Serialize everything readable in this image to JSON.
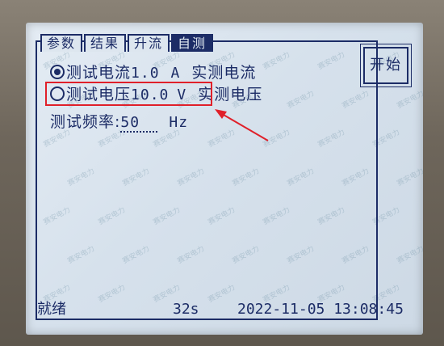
{
  "tabs": [
    {
      "label": "参数",
      "active": false
    },
    {
      "label": "结果",
      "active": false
    },
    {
      "label": "升流",
      "active": false
    },
    {
      "label": "自测",
      "active": true
    }
  ],
  "rows": {
    "current": {
      "label": "测试电流",
      "value": "1.0",
      "unit": "A",
      "measured_label": "实测电流",
      "checked": true
    },
    "voltage": {
      "label": "测试电压",
      "value": "10.0",
      "unit": "V",
      "measured_label": "实测电压",
      "checked": false
    },
    "frequency": {
      "label": "测试频率",
      "separator": ":",
      "value": "50",
      "unit": "Hz"
    }
  },
  "start_button": {
    "label": "开始"
  },
  "status": {
    "state": "就绪",
    "elapsed": "32s",
    "datetime": "2022-11-05 13:08:45"
  },
  "watermark": "赛安电力",
  "colors": {
    "lcd_text": "#1c2c66",
    "highlight": "#e0202a",
    "lcd_bg": "#dde6ef"
  }
}
